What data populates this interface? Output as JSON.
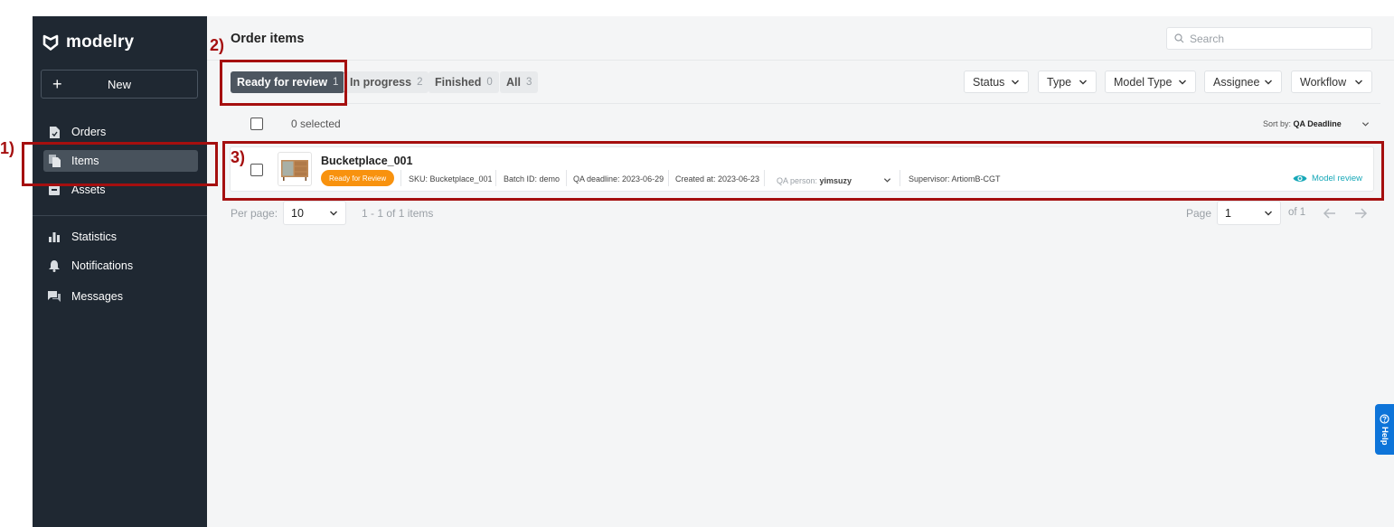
{
  "app": {
    "brand": "modelry"
  },
  "sidebar": {
    "new_label": "New",
    "items": [
      {
        "label": "Orders",
        "icon": "document-icon"
      },
      {
        "label": "Items",
        "icon": "files-icon",
        "active": true
      },
      {
        "label": "Assets",
        "icon": "box-icon"
      },
      {
        "label": "Statistics",
        "icon": "bar-chart-icon"
      },
      {
        "label": "Notifications",
        "icon": "bell-icon"
      },
      {
        "label": "Messages",
        "icon": "chat-icon"
      }
    ]
  },
  "header": {
    "title": "Order items",
    "search_placeholder": "Search"
  },
  "tabs": [
    {
      "label": "Ready for review",
      "count": "1",
      "active": true
    },
    {
      "label": "In progress",
      "count": "2"
    },
    {
      "label": "Finished",
      "count": "0"
    },
    {
      "label": "All",
      "count": "3"
    }
  ],
  "filters": [
    "Status",
    "Type",
    "Model Type",
    "Assignee",
    "Workflow"
  ],
  "list_header": {
    "selected_text": "0 selected",
    "sort_label": "Sort by:",
    "sort_value": "QA Deadline"
  },
  "item": {
    "title": "Bucketplace_001",
    "status": "Ready for Review",
    "sku": "SKU: Bucketplace_001",
    "batch": "Batch ID: demo",
    "qa_deadline": "QA deadline: 2023-06-29",
    "created": "Created at: 2023-06-23",
    "qa_person_label": "QA person:",
    "qa_person": "yimsuzy",
    "supervisor": "Supervisor: ArtiomB-CGT",
    "action": "Model review"
  },
  "pagination": {
    "per_page_label": "Per page:",
    "per_page_value": "10",
    "range": "1 - 1 of 1 items",
    "page_label": "Page",
    "page_value": "1",
    "of_pages": "of 1"
  },
  "annotations": [
    "1)",
    "2)",
    "3)"
  ],
  "help_label": "Help",
  "colors": {
    "sidebar_bg": "#1f2832",
    "status_orange": "#f8920e",
    "link_teal": "#17a8b8",
    "annotation_red": "#a50f0f",
    "help_blue": "#0d74d9"
  }
}
